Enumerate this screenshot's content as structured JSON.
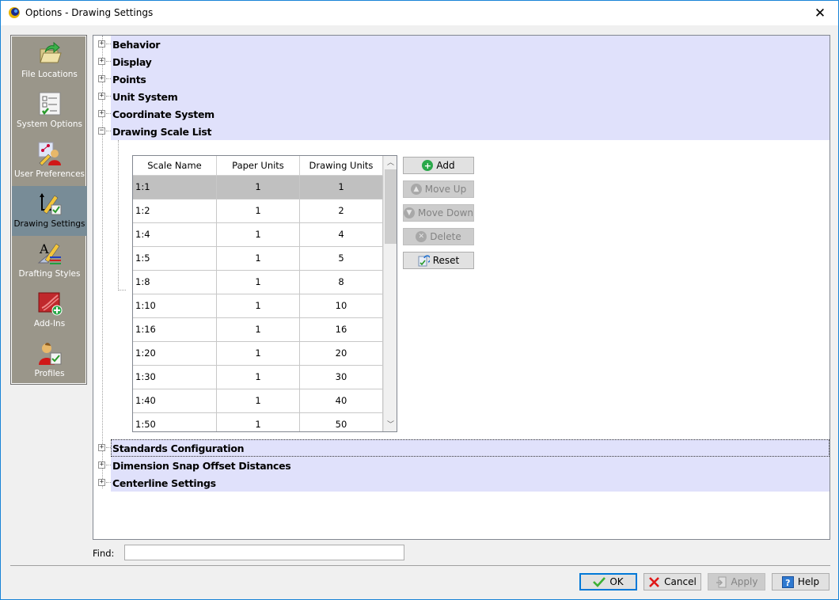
{
  "window": {
    "title": "Options - Drawing Settings",
    "close_label": "✕"
  },
  "nav": {
    "items": [
      {
        "label": "File Locations",
        "icon": "folder-arrow-icon",
        "active": false
      },
      {
        "label": "System Options",
        "icon": "checklist-icon",
        "active": false
      },
      {
        "label": "User Preferences",
        "icon": "user-pencil-icon",
        "active": false
      },
      {
        "label": "Drawing Settings",
        "icon": "axes-pencil-icon",
        "active": true
      },
      {
        "label": "Drafting Styles",
        "icon": "text-style-icon",
        "active": false
      },
      {
        "label": "Add-Ins",
        "icon": "addin-plus-icon",
        "active": false
      },
      {
        "label": "Profiles",
        "icon": "profile-icon",
        "active": false
      }
    ]
  },
  "tree": {
    "sections_top": [
      {
        "label": "Behavior",
        "expanded": false
      },
      {
        "label": "Display",
        "expanded": false
      },
      {
        "label": "Points",
        "expanded": false
      },
      {
        "label": "Unit System",
        "expanded": false
      },
      {
        "label": "Coordinate System",
        "expanded": false
      },
      {
        "label": "Drawing Scale List",
        "expanded": true
      }
    ],
    "sections_bottom": [
      {
        "label": "Standards Configuration",
        "expanded": false,
        "focused": true
      },
      {
        "label": "Dimension Snap Offset Distances",
        "expanded": false
      },
      {
        "label": "Centerline Settings",
        "expanded": false
      }
    ],
    "expand_glyph": "+",
    "collapse_glyph": "−"
  },
  "scale_table": {
    "columns": [
      "Scale Name",
      "Paper Units",
      "Drawing Units"
    ],
    "rows": [
      [
        "1:1",
        "1",
        "1"
      ],
      [
        "1:2",
        "1",
        "2"
      ],
      [
        "1:4",
        "1",
        "4"
      ],
      [
        "1:5",
        "1",
        "5"
      ],
      [
        "1:8",
        "1",
        "8"
      ],
      [
        "1:10",
        "1",
        "10"
      ],
      [
        "1:16",
        "1",
        "16"
      ],
      [
        "1:20",
        "1",
        "20"
      ],
      [
        "1:30",
        "1",
        "30"
      ],
      [
        "1:40",
        "1",
        "40"
      ],
      [
        "1:50",
        "1",
        "50"
      ]
    ],
    "selected_row": 0
  },
  "scale_buttons": {
    "add": "Add",
    "move_up": "Move Up",
    "move_down": "Move Down",
    "delete": "Delete",
    "reset": "Reset"
  },
  "find": {
    "label": "Find:",
    "value": ""
  },
  "dialog_buttons": {
    "ok": "OK",
    "cancel": "Cancel",
    "apply": "Apply",
    "help": "Help"
  },
  "colors": {
    "nav_bg": "#9a968a",
    "nav_active": "#788c97",
    "section_bg": "#e0e1fb",
    "selected_row": "#c0c0c0",
    "accent": "#0078d7"
  }
}
